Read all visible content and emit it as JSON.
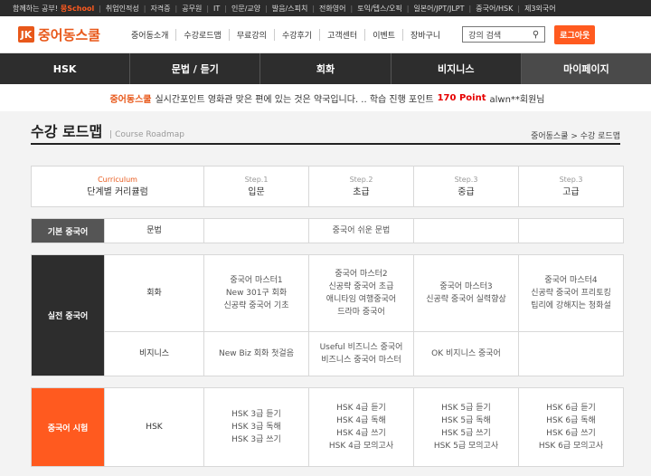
{
  "topbar": {
    "items": [
      "함께하는 공부!",
      "뭉School",
      "취업인적성",
      "자격증",
      "공무원",
      "IT",
      "인문/교양",
      "발음/스피치",
      "전화영어",
      "토익/텝스/오픽",
      "일본어/JPT/JLPT",
      "중국어/HSK",
      "제3외국어"
    ]
  },
  "header": {
    "logo_mark": "JK",
    "logo_text": "중어동스쿨",
    "menu": [
      "중어동소개",
      "수강로드맵",
      "무료강의",
      "수강후기",
      "고객센터",
      "이벤트",
      "장바구니"
    ],
    "search_placeholder": "강의 검색",
    "search_icon": "search-icon",
    "logout": "로그아웃"
  },
  "gnb": [
    "HSK",
    "문법 / 듣기",
    "회화",
    "비지니스",
    "마이페이지"
  ],
  "ticker": {
    "brand": "중어동스쿨",
    "text": "실시간포인트 영화관 맞은 편에 있는 것은 약국입니다. .. 학습 진행 포인트",
    "points": "170 Point",
    "user": "alwn**회원님"
  },
  "page": {
    "title": "수강 로드맵",
    "subtitle": "Course Roadmap",
    "breadcrumb": "중어동스쿨 > 수강 로드맵"
  },
  "roadmap": {
    "header": {
      "curriculum": "Curriculum",
      "curriculum_label": "단계별 커리큘럼",
      "steps": [
        {
          "step": "Step.1",
          "level": "입문"
        },
        {
          "step": "Step.2",
          "level": "초급"
        },
        {
          "step": "Step.3",
          "level": "중급"
        },
        {
          "step": "Step.3",
          "level": "고급"
        }
      ]
    },
    "basic": {
      "category": "기본 중국어",
      "sub": "문법",
      "cells": [
        "",
        "중국어 쉬운 문법",
        "",
        ""
      ]
    },
    "practical": {
      "category": "실전 중국어",
      "rows": [
        {
          "sub": "회화",
          "cells": [
            [
              "중국어 마스터1",
              "New 301구 회화",
              "신공략 중국어 기초"
            ],
            [
              "중국어 마스터2",
              "신공략 중국어 초급",
              "애니타임 여행중국어",
              "드라마 중국어"
            ],
            [
              "중국어 마스터3",
              "신공략 중국어 실력향상"
            ],
            [
              "중국어 마스터4",
              "신공략 중국어 프리토킹",
              "팁리에 강해지는 청화설"
            ]
          ]
        },
        {
          "sub": "비지니스",
          "cells": [
            [
              "New Biz 회화 첫걸음"
            ],
            [
              "Useful 비즈니스 중국어",
              "비즈니스 중국어 마스터"
            ],
            [
              "OK 비지니스 중국어"
            ],
            []
          ]
        }
      ]
    },
    "exam": {
      "category": "중국어 시험",
      "sub": "HSK",
      "cells": [
        [
          "HSK 3급 듣기",
          "HSK 3급 독해",
          "HSK 3급 쓰기"
        ],
        [
          "HSK 4급 듣기",
          "HSK 4급 독해",
          "HSK 4급 쓰기",
          "HSK 4급 모의고사"
        ],
        [
          "HSK 5급 듣기",
          "HSK 5급 독해",
          "HSK 5급 쓰기",
          "HSK 5급 모의고사"
        ],
        [
          "HSK 6급 듣기",
          "HSK 6급 독해",
          "HSK 6급 쓰기",
          "HSK 6급 모의고사"
        ]
      ]
    }
  }
}
